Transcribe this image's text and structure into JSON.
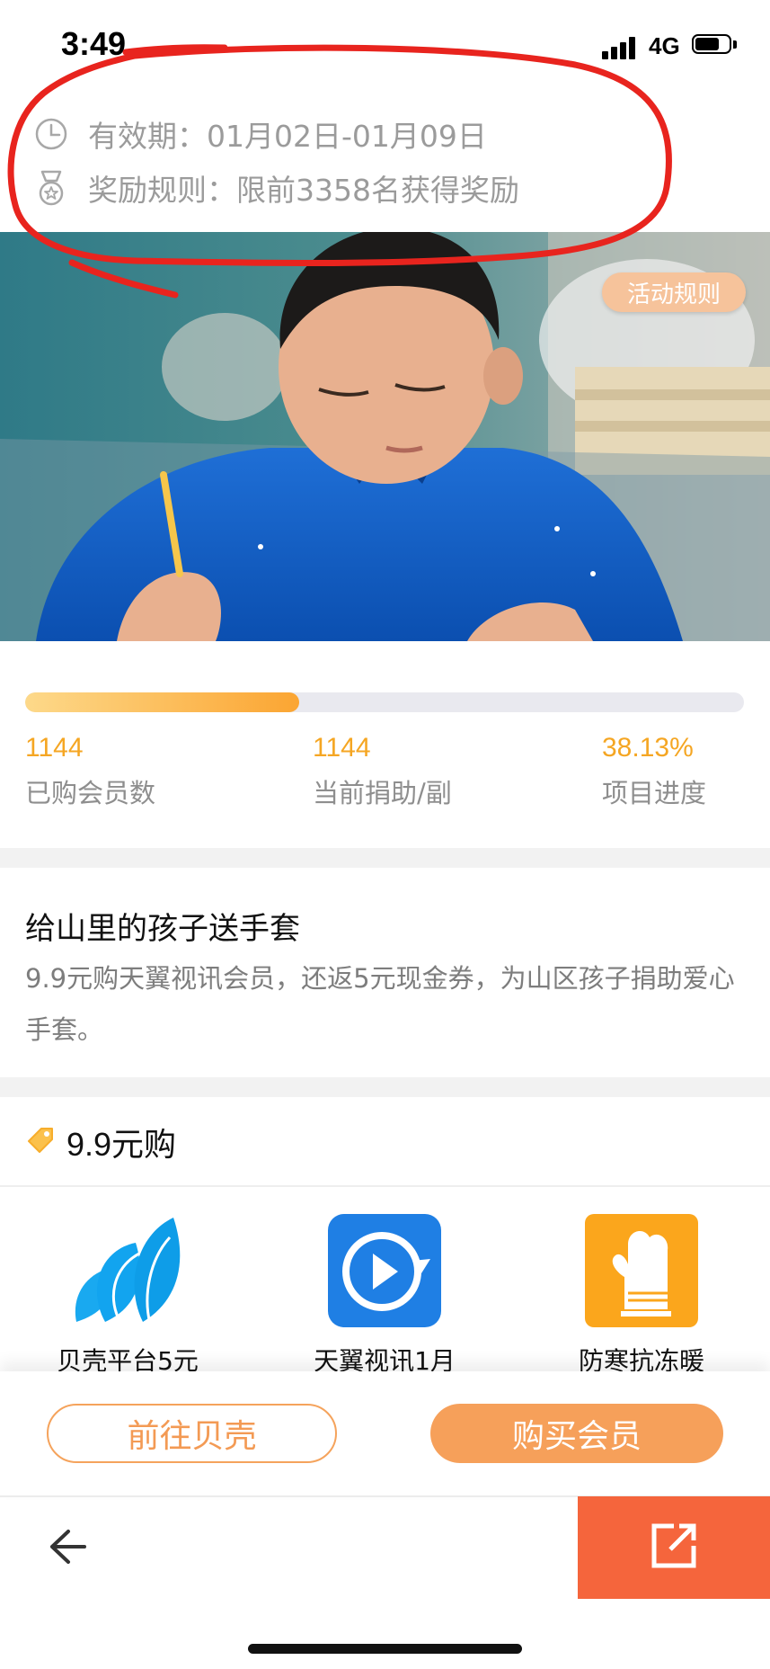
{
  "status_bar": {
    "time": "3:49",
    "network": "4G",
    "icons": [
      "signal-icon",
      "battery-icon"
    ]
  },
  "info": {
    "validity": "有效期：01月02日-01月09日",
    "reward_rule": "奖励规则：限前3358名获得奖励",
    "icons": [
      "clock-icon",
      "medal-icon"
    ]
  },
  "banner": {
    "rules_button": "活动规则"
  },
  "progress": {
    "percent_fill": 0.3813
  },
  "stats": [
    {
      "value": "1144",
      "label": "已购会员数"
    },
    {
      "value": "1144",
      "label": "当前捐助/副"
    },
    {
      "value": "38.13%",
      "label": "项目进度"
    }
  ],
  "campaign": {
    "title": "给山里的孩子送手套",
    "description": "9.9元购天翼视讯会员，还返5元现金券，为山区孩子捐助爱心手套。"
  },
  "offer": {
    "label": "9.9元购",
    "icon": "tag-icon"
  },
  "products": [
    {
      "name": "贝壳平台5元",
      "icon": "shell-logo-icon"
    },
    {
      "name": "天翼视讯1月",
      "icon": "play-logo-icon"
    },
    {
      "name": "防寒抗冻暖",
      "icon": "glove-icon"
    }
  ],
  "actions": {
    "goto_shell": "前往贝壳",
    "buy_member": "购买会员"
  },
  "toolbar": {
    "icons": [
      "back-arrow-icon",
      "share-icon"
    ]
  },
  "colors": {
    "accent": "#f6a05a",
    "share": "#f5653c",
    "stat_number": "#f5a623",
    "annotation": "#e8241e"
  }
}
